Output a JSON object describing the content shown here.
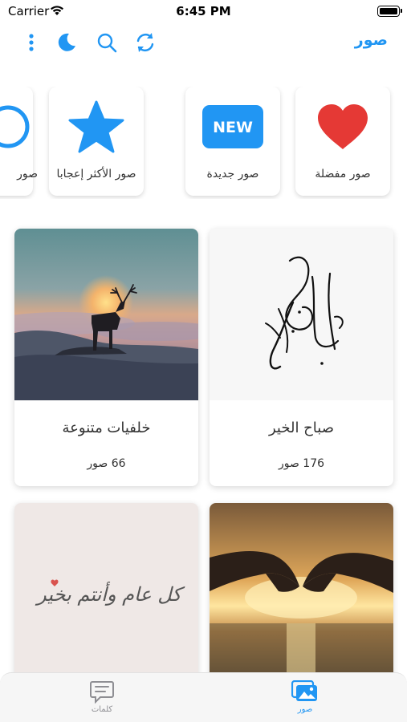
{
  "status_bar": {
    "carrier": "Carrier",
    "time": "6:45 PM"
  },
  "nav": {
    "title": "صور",
    "accent": "#2196f3"
  },
  "categories": [
    {
      "label": "صور مفضلة",
      "icon": "heart-icon"
    },
    {
      "label": "صور جديدة",
      "icon": "new-badge-icon",
      "badge_text": "NEW"
    },
    {
      "label": "صور الأكثر إعجابا",
      "icon": "star-icon"
    },
    {
      "label": "صور",
      "icon": "partial-icon"
    }
  ],
  "albums": [
    {
      "title": "صباح الخير",
      "count": "176 صور",
      "image": "calligraphy-good-morning"
    },
    {
      "title": "خلفيات متنوعة",
      "count": "66 صور",
      "image": "deer-sunset"
    },
    {
      "title": "",
      "count": "",
      "image": "heart-hands-sunset"
    },
    {
      "title": "",
      "count": "",
      "image": "calligraphy-greeting",
      "image_text": "كل عام وأنتم بخير"
    }
  ],
  "tabs": [
    {
      "label": "صور",
      "icon": "images-icon",
      "active": true
    },
    {
      "label": "كلمات",
      "icon": "chat-icon",
      "active": false
    }
  ]
}
